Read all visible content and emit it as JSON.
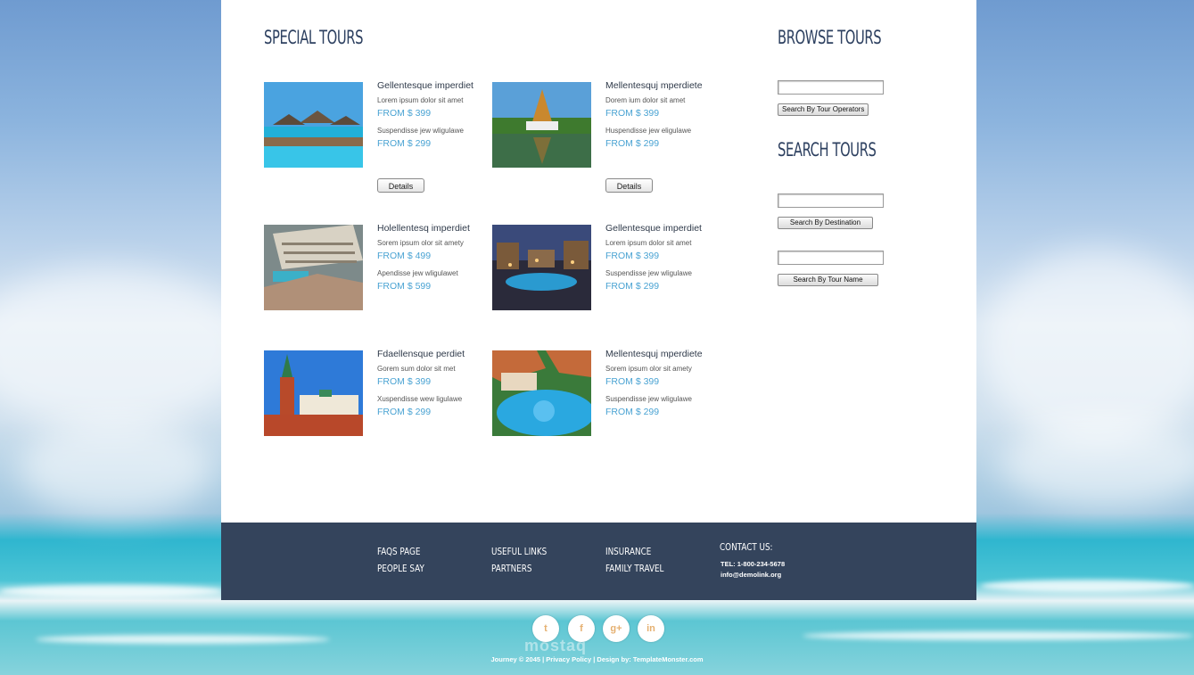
{
  "main": {
    "special_tours_title": "SPECIAL TOURS",
    "tours": [
      {
        "title": "Gellentesque imperdiet",
        "line1": "Lorem ipsum dolor sit amet",
        "price1": "FROM $ 399",
        "line2": "Suspendisse jew wligulawe",
        "price2": "FROM $ 299",
        "details": "Details"
      },
      {
        "title": "Mellentesquj mperdiete",
        "line1": "Dorem ium dolor sit amet",
        "price1": "FROM $ 399",
        "line2": "Huspendisse jew eligulawe",
        "price2": "FROM $ 299",
        "details": "Details"
      },
      {
        "title": "Holellentesq imperdiet",
        "line1": "Sorem ipsum olor sit amety",
        "price1": "FROM $ 499",
        "line2": "Apendisse jew wligulawet",
        "price2": "FROM $ 599"
      },
      {
        "title": "Gellentesque imperdiet",
        "line1": "Lorem ipsum dolor sit amet",
        "price1": "FROM $ 399",
        "line2": "Suspendisse jew wligulawe",
        "price2": "FROM $ 299"
      },
      {
        "title": "Fdaellensque perdiet",
        "line1": "Gorem sum dolor sit met",
        "price1": "FROM $ 399",
        "line2": "Xuspendisse wew ligulawe",
        "price2": "FROM $ 299"
      },
      {
        "title": "Mellentesquj mperdiete",
        "line1": "Sorem ipsum olor sit amety",
        "price1": "FROM $ 399",
        "line2": "Suspendisse jew wligulawe",
        "price2": "FROM $ 299"
      }
    ]
  },
  "sidebar": {
    "browse_title": "BROWSE TOURS",
    "browse_button": "Search By Tour Operators",
    "search_title": "SEARCH TOURS",
    "destination_button": "Search By Destination",
    "name_button": "Search By Tour Name"
  },
  "footer": {
    "links": [
      "FAQS PAGE",
      "PEOPLE SAY",
      "USEFUL LINKS",
      "PARTNERS",
      "INSURANCE",
      "FAMILY TRAVEL"
    ],
    "contact_title": "CONTACT US:",
    "phone": "TEL: 1-800-234-5678",
    "email": "info@demolink.org"
  },
  "social": {
    "icons": [
      "twitter-icon",
      "facebook-icon",
      "google-plus-icon",
      "linkedin-icon"
    ],
    "glyphs": [
      "t",
      "f",
      "g+",
      "in"
    ]
  },
  "watermark": "mostaq",
  "copyright": "Journey © 2045 | Privacy Policy | Design by: TemplateMonster.com",
  "colors": {
    "heading": "#2d4060",
    "price": "#4aa3d3",
    "footer_bg": "#34445c",
    "social_glyph": "#e5b070"
  }
}
